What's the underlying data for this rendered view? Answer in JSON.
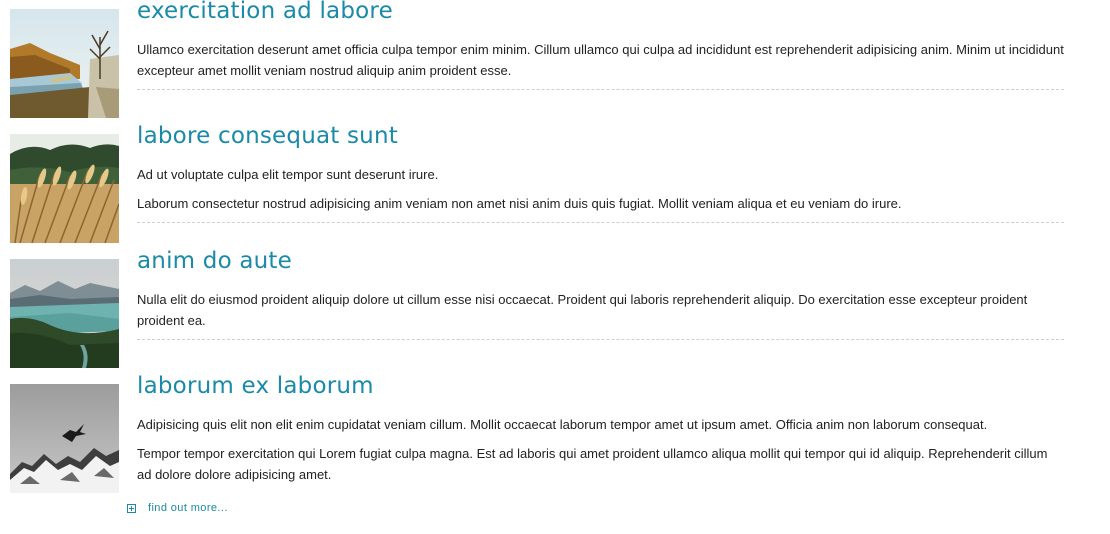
{
  "items": [
    {
      "title": "exercitation ad labore",
      "image": "autumn-lake-path-photo",
      "paragraphs": [
        "Ullamco exercitation deserunt amet officia culpa tempor enim minim. Cillum ullamco qui culpa ad incididunt est reprehenderit adipisicing anim. Minim ut incididunt excepteur amet mollit veniam nostrud aliquip anim proident esse."
      ]
    },
    {
      "title": "labore consequat sunt",
      "image": "wheat-field-photo",
      "paragraphs": [
        "Ad ut voluptate culpa elit tempor sunt deserunt irure.",
        "Laborum consectetur nostrud adipisicing anim veniam non amet nisi anim duis quis fugiat. Mollit veniam aliqua et eu veniam do irure."
      ]
    },
    {
      "title": "anim do aute",
      "image": "mountain-lake-photo",
      "paragraphs": [
        "Nulla elit do eiusmod proident aliquip dolore ut cillum esse nisi occaecat. Proident qui laboris reprehenderit aliquip. Do exercitation esse excepteur proident proident ea."
      ]
    },
    {
      "title": "laborum ex laborum",
      "image": "bird-over-snowy-mountains-photo",
      "paragraphs": [
        "Adipisicing quis elit non elit enim cupidatat veniam cillum. Mollit occaecat laborum tempor amet ut ipsum amet. Officia anim non laborum consequat.",
        "Tempor tempor exercitation qui Lorem fugiat culpa magna. Est ad laboris qui amet proident ullamco aliqua mollit qui tempor qui id aliquip. Reprehenderit cillum ad dolore dolore adipisicing amet."
      ]
    }
  ],
  "more_link": {
    "label": "find out more...",
    "icon": "plus-square-icon"
  },
  "colors": {
    "accent": "#1a8aa8",
    "text": "#222222",
    "divider": "#cfcfcf"
  }
}
